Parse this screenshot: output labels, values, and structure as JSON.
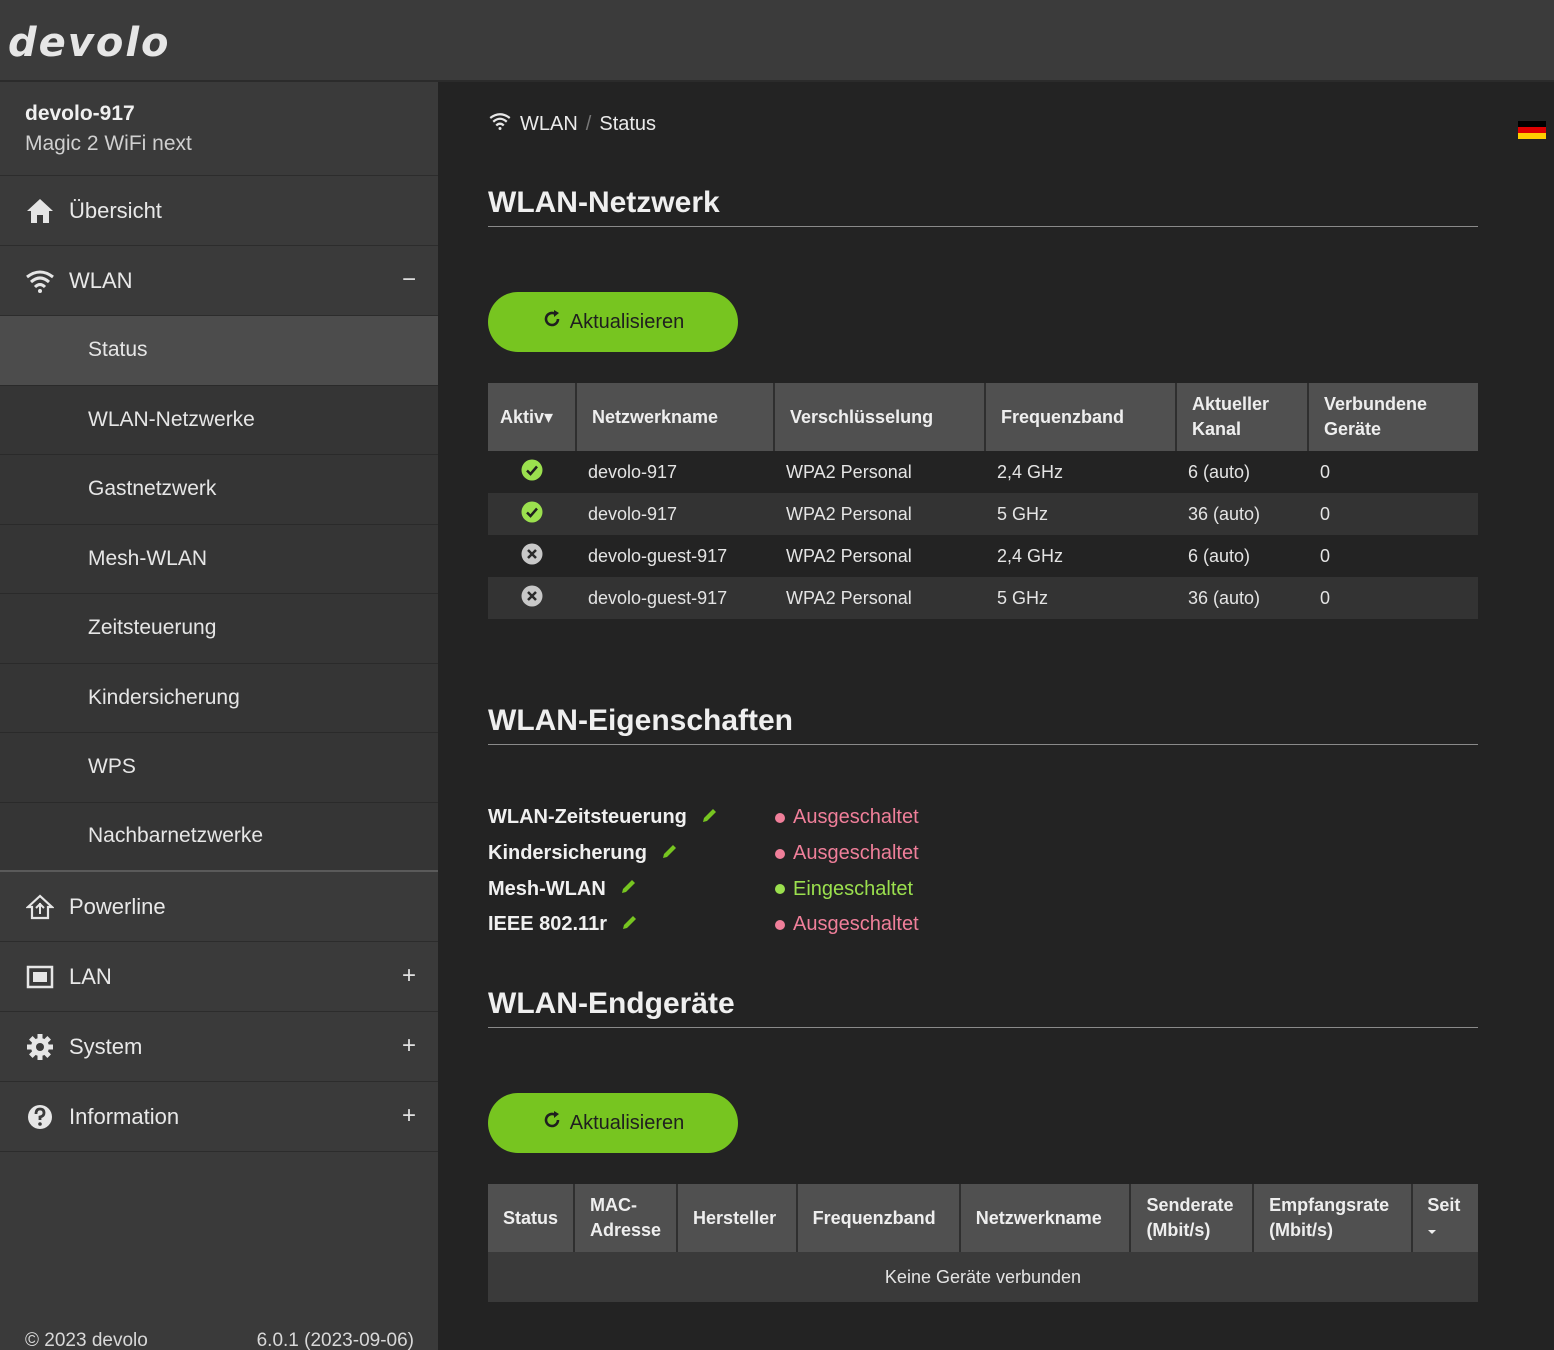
{
  "brand": {
    "logo": "devolo"
  },
  "device": {
    "name": "devolo-917",
    "model": "Magic 2 WiFi next"
  },
  "nav": {
    "overview": "Übersicht",
    "wlan": "WLAN",
    "wlan_toggle": "−",
    "wlan_sub": [
      "Status",
      "WLAN-Netzwerke",
      "Gastnetzwerk",
      "Mesh-WLAN",
      "Zeitsteuerung",
      "Kindersicherung",
      "WPS",
      "Nachbarnetzwerke"
    ],
    "powerline": "Powerline",
    "lan": "LAN",
    "system": "System",
    "information": "Information",
    "expand_toggle": "+"
  },
  "footer": {
    "copyright": "© 2023 devolo",
    "version": "6.0.1 (2023-09-06)"
  },
  "breadcrumb": {
    "section": "WLAN",
    "sep": "/",
    "page": "Status"
  },
  "networks": {
    "title": "WLAN-Netzwerk",
    "refresh": "Aktualisieren",
    "headers": [
      "Aktiv▾",
      "Netzwerkname",
      "Verschlüsselung",
      "Frequenzband",
      "Aktueller Kanal",
      "Verbundene Geräte"
    ],
    "rows": [
      {
        "active": true,
        "name": "devolo-917",
        "enc": "WPA2 Personal",
        "band": "2,4 GHz",
        "channel": "6 (auto)",
        "devices": "0"
      },
      {
        "active": true,
        "name": "devolo-917",
        "enc": "WPA2 Personal",
        "band": "5 GHz",
        "channel": "36 (auto)",
        "devices": "0"
      },
      {
        "active": false,
        "name": "devolo-guest-917",
        "enc": "WPA2 Personal",
        "band": "2,4 GHz",
        "channel": "6 (auto)",
        "devices": "0"
      },
      {
        "active": false,
        "name": "devolo-guest-917",
        "enc": "WPA2 Personal",
        "band": "5 GHz",
        "channel": "36 (auto)",
        "devices": "0"
      }
    ]
  },
  "properties": {
    "title": "WLAN-Eigenschaften",
    "items": [
      {
        "label": "WLAN-Zeitsteuerung",
        "status": "Ausgeschaltet",
        "on": false
      },
      {
        "label": "Kindersicherung",
        "status": "Ausgeschaltet",
        "on": false
      },
      {
        "label": "Mesh-WLAN",
        "status": "Eingeschaltet",
        "on": true
      },
      {
        "label": "IEEE 802.11r",
        "status": "Ausgeschaltet",
        "on": false
      }
    ]
  },
  "clients": {
    "title": "WLAN-Endgeräte",
    "refresh": "Aktualisieren",
    "headers": [
      "Status",
      "MAC-Adresse",
      "Hersteller",
      "Frequenzband",
      "Netzwerkname",
      "Senderate (Mbit/s)",
      "Empfangsrate (Mbit/s)",
      "Seit"
    ],
    "empty": "Keine Geräte verbunden"
  },
  "colors": {
    "accent": "#77c520",
    "on": "#9be04e",
    "off": "#f07f9a",
    "flag": [
      "#000000",
      "#dd0000",
      "#ffce00"
    ]
  },
  "icons": {
    "refresh": "refresh-icon",
    "edit": "pencil-icon",
    "active": "check-circle-icon",
    "inactive": "x-circle-icon"
  }
}
